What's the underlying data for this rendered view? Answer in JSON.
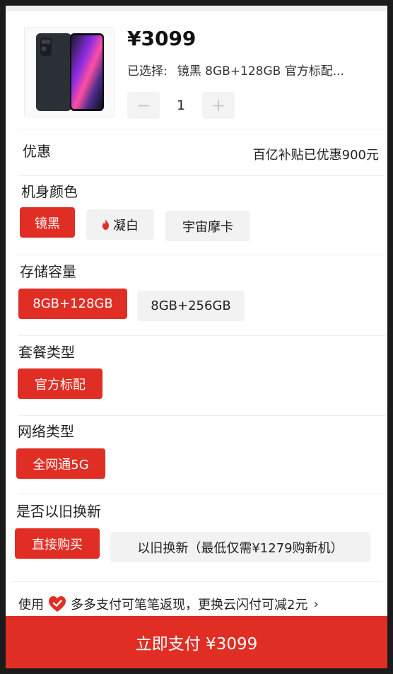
{
  "product": {
    "price": "¥3099",
    "selected_label": "已选择:",
    "selected_value": "镜黑 8GB+128GB 官方标配...",
    "quantity": "1",
    "minus": "−",
    "plus": "+"
  },
  "discount": {
    "label": "优惠",
    "value": "百亿补贴已优惠900元"
  },
  "color": {
    "title": "机身颜色",
    "options": [
      "镜黑",
      "凝白",
      "宇宙摩卡"
    ],
    "selected": "镜黑"
  },
  "storage": {
    "title": "存储容量",
    "options": [
      "8GB+128GB",
      "8GB+256GB"
    ],
    "selected": "8GB+128GB"
  },
  "package": {
    "title": "套餐类型",
    "options": [
      "官方标配"
    ],
    "selected": "官方标配"
  },
  "network": {
    "title": "网络类型",
    "options": [
      "全网通5G"
    ],
    "selected": "全网通5G"
  },
  "tradein": {
    "title": "是否以旧换新",
    "options": [
      "直接购买",
      "以旧换新（最低仅需¥1279购新机）"
    ],
    "selected": "直接购买"
  },
  "payment": {
    "prefix": "使用",
    "text": "多多支付可笔笔返现，更换云闪付可减2元",
    "chevron": "›"
  },
  "pay_button": "立即支付 ¥3099",
  "colors": {
    "accent": "#e02e24",
    "chip_bg": "#f2f2f2"
  },
  "icons": [
    "phone-thumbnail",
    "flame-icon",
    "heart-icon",
    "chevron-right-icon"
  ]
}
